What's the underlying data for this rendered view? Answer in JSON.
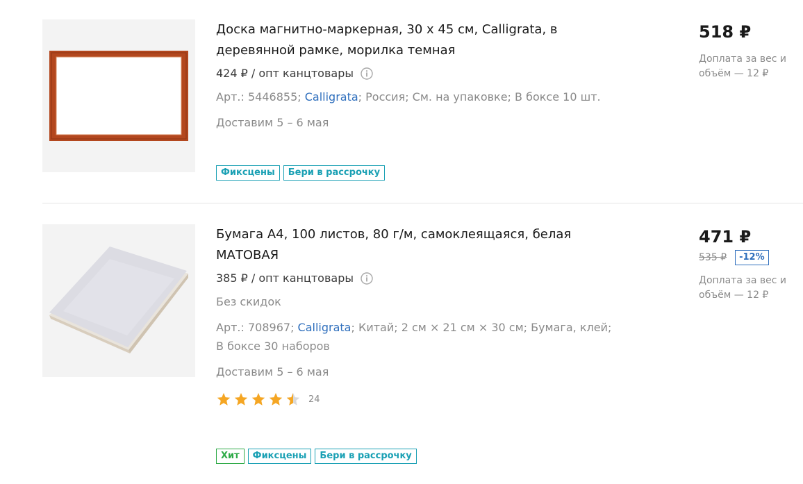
{
  "products": [
    {
      "title": "Доска магнитно-маркерная, 30 х 45 см, Calligrata, в деревянной рамке, морилка темная",
      "wholesale_price": "424 ₽ / опт канцтовары",
      "meta_prefix": "Арт.: 5446855; ",
      "brand": "Calligrata",
      "meta_suffix": "; Россия; См. на упаковке; В боксе 10 шт.",
      "delivery": "Доставим 5 – 6 мая",
      "price": "518 ₽",
      "surcharge": "Доплата за вес и объём — 12 ₽",
      "badges": [
        "Фиксцены",
        "Бери в рассрочку"
      ],
      "frame_color": "#b3471e"
    },
    {
      "title": "Бумага А4, 100 листов, 80 г/м, самоклеящаяся, белая МАТОВАЯ",
      "wholesale_price": "385 ₽ / опт канцтовары",
      "discount_note": "Без скидок",
      "meta_prefix": "Арт.: 708967; ",
      "brand": "Calligrata",
      "meta_suffix": "; Китай; 2 см × 21 см × 30 см; Бумага, клей; В боксе 30 наборов",
      "delivery": "Доставим 5 – 6 мая",
      "rating": 4.5,
      "rating_count": "24",
      "price": "471 ₽",
      "old_price": "535 ₽",
      "discount": "-12%",
      "surcharge": "Доплата за вес и объём — 12 ₽",
      "badges": [
        "Хит",
        "Фиксцены",
        "Бери в рассрочку"
      ]
    }
  ],
  "colors": {
    "accent_link": "#2f6fbd",
    "badge_teal": "#1aa0b4",
    "badge_green": "#2eaa47",
    "star": "#f5a623"
  },
  "icons": {
    "info": "info-icon",
    "star": "star-icon",
    "half_star": "star-half-icon"
  }
}
